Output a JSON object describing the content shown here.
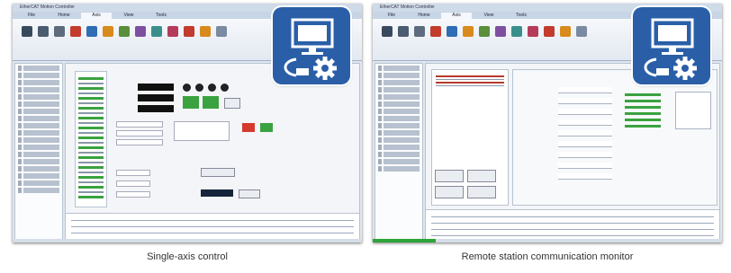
{
  "left_panel": {
    "caption": "Single-axis control",
    "titlebar": "EtherCAT Motion Controller",
    "tabs": [
      "File",
      "Home",
      "Axis",
      "View",
      "Tools"
    ]
  },
  "right_panel": {
    "caption": "Remote station communication monitor",
    "titlebar": "EtherCAT Motion Controller",
    "tabs": [
      "File",
      "Home",
      "Axis",
      "View",
      "Tools"
    ]
  },
  "badge_icon": "monitor-network-gear-icon",
  "colors": {
    "badge_blue": "#2a5fa8",
    "window_bg": "#dfe6ee",
    "status_green": "#2ea43a"
  }
}
